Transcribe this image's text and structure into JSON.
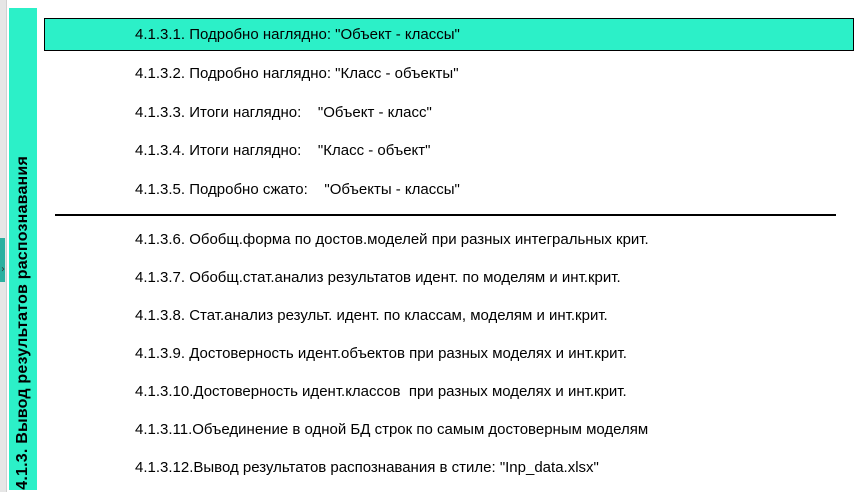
{
  "side_panel": {
    "label": "4.1.3. Вывод результатов распознавания",
    "accent_color": "#2cf0c8"
  },
  "menu": {
    "items": [
      {
        "label": "4.1.3.1. Подробно наглядно: \"Объект - классы\"",
        "selected": true
      },
      {
        "label": "4.1.3.2. Подробно наглядно: \"Класс - объекты\"",
        "selected": false
      },
      {
        "label": "4.1.3.3. Итоги наглядно:    \"Объект - класс\"",
        "selected": false
      },
      {
        "label": "4.1.3.4. Итоги наглядно:    \"Класс - объект\"",
        "selected": false
      },
      {
        "label": "4.1.3.5. Подробно сжато:    \"Объекты - классы\"",
        "selected": false
      },
      {
        "label": "4.1.3.6. Обобщ.форма по достов.моделей при разных интегральных крит.",
        "selected": false
      },
      {
        "label": "4.1.3.7. Обобщ.стат.анализ результатов идент. по моделям и инт.крит.",
        "selected": false
      },
      {
        "label": "4.1.3.8. Стат.анализ результ. идент. по классам, моделям и инт.крит.",
        "selected": false
      },
      {
        "label": "4.1.3.9. Достоверность идент.объектов при разных моделях и инт.крит.",
        "selected": false
      },
      {
        "label": "4.1.3.10.Достоверность идент.классов  при разных моделях и инт.крит.",
        "selected": false
      },
      {
        "label": "4.1.3.11.Объединение в одной БД строк по самым достоверным моделям",
        "selected": false
      },
      {
        "label": "4.1.3.12.Вывод результатов распознавания в стиле: \"Inp_data.xlsx\"",
        "selected": false
      }
    ]
  }
}
